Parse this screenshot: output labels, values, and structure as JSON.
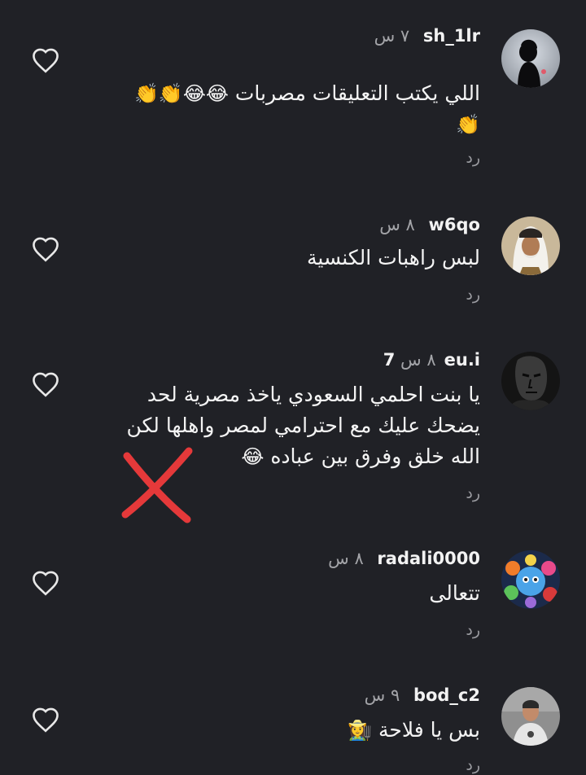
{
  "comments": [
    {
      "username": "sh_1lr",
      "time": "٧ س",
      "text": "اللي يكتب التعليقات مصربات",
      "emojis": "😂😂👏👏👏",
      "reply": "رد",
      "avatar_icon": "woman-silhouette-avatar"
    },
    {
      "username": "w6qo",
      "time": "٨ س",
      "text": "لبس راهبات الكنسية",
      "emojis": "",
      "reply": "رد",
      "avatar_icon": "man-in-ghutra-avatar"
    },
    {
      "username": "7eu.i",
      "time": "٨ س",
      "text": "يا بنت احلمي السعودي ياخذ مصرية لحد يضحك عليك مع احترامي لمصر واهلها لكن الله خلق وفرق بين عباده",
      "emojis": "😂",
      "reply": "رد",
      "avatar_icon": "dark-statue-avatar"
    },
    {
      "username": "radali0000",
      "time": "٨ س",
      "text": "تتعالى",
      "emojis": "",
      "reply": "رد",
      "avatar_icon": "cartoon-characters-avatar"
    },
    {
      "username": "bod_c2",
      "time": "٩ س",
      "text": "بس يا فلاحة",
      "emojis": "👩‍🌾",
      "reply": "رد",
      "avatar_icon": "person-photo-avatar"
    }
  ],
  "annotation": {
    "icon": "red-x-mark",
    "color": "#e5393a"
  },
  "colors": {
    "background": "#202126",
    "text": "#f2f2f2",
    "muted": "#a3a4a8",
    "heart_outline": "#e8e8e8"
  }
}
